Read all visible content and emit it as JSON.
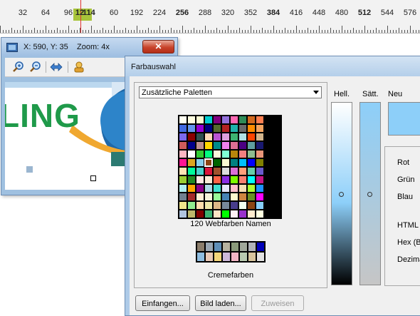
{
  "ruler": {
    "labels": [
      "32",
      "64",
      "96",
      "12",
      "60",
      "192",
      "224",
      "256",
      "288",
      "320",
      "352",
      "384",
      "416",
      "448",
      "480",
      "512",
      "544",
      "576"
    ],
    "cursor_value": "114",
    "highlight_color": "#a8c43a",
    "marker_color": "#e03030"
  },
  "zoom_window": {
    "title": "X: 590, Y: 35    Zoom: 4x",
    "close_glyph": "✕",
    "toolbar_icons": [
      "zoom-in-icon",
      "zoom-out-icon",
      "pan-arrows-icon",
      "hand-grab-icon"
    ],
    "preview_text": "LING"
  },
  "farbauswahl": {
    "title": "Farbauswahl",
    "palette_select": "Zusätzliche Paletten",
    "palette1_caption": "120 Webfarben Namen",
    "palette2_caption": "Cremefarben",
    "buttons": {
      "capture": "Einfangen...",
      "load_image": "Bild laden...",
      "assign": "Zuweisen"
    },
    "labels": {
      "hell": "Hell.",
      "saett": "Sätt.",
      "neu": "Neu",
      "rot": "Rot",
      "gruen": "Grün",
      "blau": "Blau",
      "html": "HTML",
      "hex": "Hex (Bl",
      "dezimal": "Dezima"
    },
    "new_color": "#8dcff9",
    "palette1_colors": [
      "#fffff0",
      "#ffffe0",
      "#fafad2",
      "#00ced1",
      "#800080",
      "#9370db",
      "#ff69b4",
      "#2e8b57",
      "#d2691e",
      "#ff7f50",
      "#4169e1",
      "#6495ed",
      "#9400d3",
      "#000080",
      "#556b2f",
      "#b22222",
      "#20b2aa",
      "#696969",
      "#ff8c00",
      "#f4a460",
      "#7b68ee",
      "#8b0000",
      "#2f4f4f",
      "#ffdab9",
      "#ba55d3",
      "#dda0dd",
      "#3cb371",
      "#b0e0e6",
      "#ff4500",
      "#d2b48c",
      "#cd5c5c",
      "#00008b",
      "#bc8f8f",
      "#ffd700",
      "#008b8b",
      "#ee82ee",
      "#db7093",
      "#4b0082",
      "#5f9ea0",
      "#191970",
      "#ffb6c1",
      "#ffffff",
      "#32cd32",
      "#00ff7f",
      "#fff8dc",
      "#7fffd4",
      "#b8860b",
      "#f08080",
      "#8fbc8f",
      "#e9967a",
      "#ff1493",
      "#daa520",
      "#87ceeb",
      "#8b4513",
      "#006400",
      "#fafad2",
      "#008080",
      "#00bfff",
      "#0000ff",
      "#808000",
      "#ffe4b5",
      "#00fa9a",
      "#48d1cc",
      "#dc143c",
      "#a0522d",
      "#dcdcdc",
      "#da70d6",
      "#ffa07a",
      "#66cdaa",
      "#6a5acd",
      "#9acd32",
      "#228b22",
      "#ffe4e1",
      "#faebd7",
      "#ff6347",
      "#8a2be2",
      "#7cfc00",
      "#fa8072",
      "#00ffff",
      "#c71585",
      "#afeeee",
      "#ffa500",
      "#8b008b",
      "#add8e6",
      "#40e0d0",
      "#e6e6fa",
      "#ffc0cb",
      "#f5deb3",
      "#adff2f",
      "#1e90ff",
      "#708090",
      "#a52a2a",
      "#ffefd5",
      "#f5f5dc",
      "#98fb98",
      "#4682b4",
      "#fffacd",
      "#cd853f",
      "#6b8e23",
      "#ff00ff",
      "#f0e68c",
      "#90ee90",
      "#ffdead",
      "#eee8aa",
      "#deb887",
      "#778899",
      "#483d8b",
      "#f0fff0",
      "#8b4513",
      "#87cefa",
      "#b0c4de",
      "#bdb76b",
      "#800000",
      "#3cb371",
      "#ffe4c4",
      "#00ff00",
      "#fff0f5",
      "#9932cc",
      "#ffebcd",
      "#ffffe0"
    ],
    "palette2_colors": [
      "#8b7d6b",
      "#9aa7b3",
      "#5f8fb8",
      "#b7b3a0",
      "#8a9a7a",
      "#a0a89a",
      "#b0b3b8",
      "#0000b8",
      "#8fbde0",
      "#e9c9b6",
      "#f3d57a",
      "#cdb9d9",
      "#f2b5c4",
      "#b9cbb0",
      "#d7c59e",
      "#e2e2e2"
    ],
    "selected_palette_index": 53
  }
}
